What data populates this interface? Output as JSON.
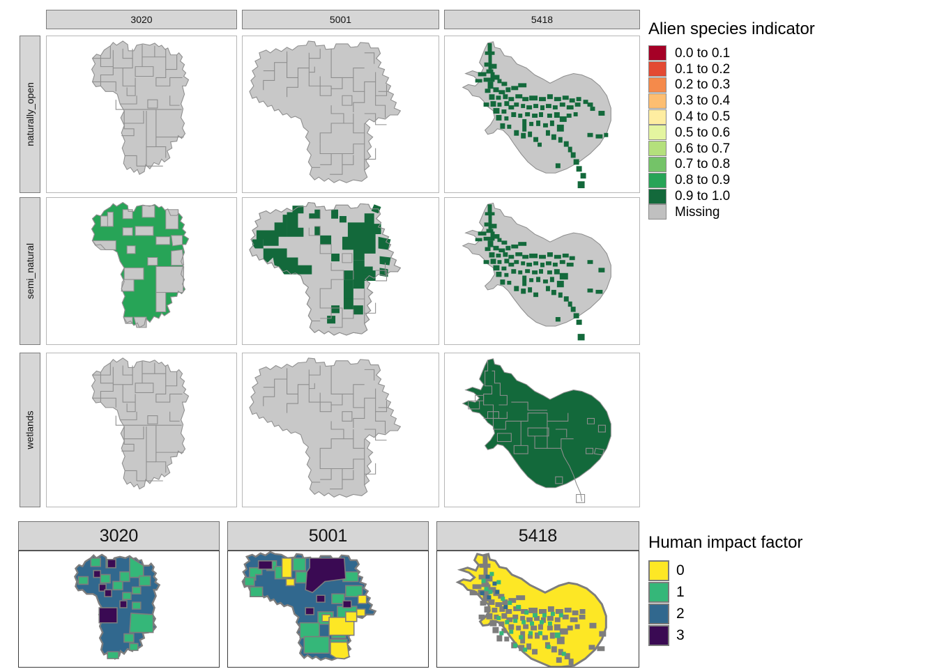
{
  "figure": {
    "kind": "faceted-choropleth-map-grid"
  },
  "top_grid": {
    "col_headers": [
      "3020",
      "5001",
      "5418"
    ],
    "row_headers": [
      "naturally_open",
      "semi_natural",
      "wetlands"
    ],
    "cells": [
      {
        "row": "naturally_open",
        "col": "3020",
        "fill_class": "Missing",
        "fill": "#c8c8c8"
      },
      {
        "row": "naturally_open",
        "col": "5001",
        "fill_class": "Missing",
        "fill": "#c8c8c8"
      },
      {
        "row": "naturally_open",
        "col": "5418",
        "fill_class": "Missing",
        "fill": "#c8c8c8",
        "overlay_class": "0.9 to 1.0",
        "overlay": "#13693b"
      },
      {
        "row": "semi_natural",
        "col": "3020",
        "fill_class": "0.8 to 0.9",
        "fill": "#27a457"
      },
      {
        "row": "semi_natural",
        "col": "5001",
        "fill_class": "0.9 to 1.0",
        "fill": "#13693b"
      },
      {
        "row": "semi_natural",
        "col": "5418",
        "fill_class": "Missing",
        "fill": "#c8c8c8",
        "overlay_class": "0.9 to 1.0",
        "overlay": "#13693b"
      },
      {
        "row": "wetlands",
        "col": "3020",
        "fill_class": "Missing",
        "fill": "#c8c8c8"
      },
      {
        "row": "wetlands",
        "col": "5001",
        "fill_class": "Missing",
        "fill": "#c8c8c8"
      },
      {
        "row": "wetlands",
        "col": "5418",
        "fill_class": "0.9 to 1.0",
        "fill": "#13693b"
      }
    ]
  },
  "bottom_grid": {
    "col_headers": [
      "3020",
      "5001",
      "5418"
    ],
    "cells": [
      {
        "col": "3020",
        "dominant_class": "2",
        "dominant": "#31688e"
      },
      {
        "col": "5001",
        "dominant_class": "2",
        "dominant": "#31688e"
      },
      {
        "col": "5418",
        "dominant_class": "0",
        "dominant": "#fde725"
      }
    ]
  },
  "legend_alien": {
    "title": "Alien species indicator",
    "items": [
      {
        "label": "0.0 to 0.1",
        "color": "#a50026"
      },
      {
        "label": "0.1 to 0.2",
        "color": "#e34a33"
      },
      {
        "label": "0.2 to 0.3",
        "color": "#f58a4b"
      },
      {
        "label": "0.3 to 0.4",
        "color": "#fdbe71"
      },
      {
        "label": "0.4 to 0.5",
        "color": "#feeda1"
      },
      {
        "label": "0.5 to 0.6",
        "color": "#e4f5a0"
      },
      {
        "label": "0.6 to 0.7",
        "color": "#b4e07c"
      },
      {
        "label": "0.7 to 0.8",
        "color": "#74c368"
      },
      {
        "label": "0.8 to 0.9",
        "color": "#27a457"
      },
      {
        "label": "0.9 to 1.0",
        "color": "#13693b"
      },
      {
        "label": "Missing",
        "color": "#c0c0c0"
      }
    ]
  },
  "legend_human": {
    "title": "Human impact factor",
    "items": [
      {
        "label": "0",
        "color": "#fde725"
      },
      {
        "label": "1",
        "color": "#35b779"
      },
      {
        "label": "2",
        "color": "#31688e"
      },
      {
        "label": "3",
        "color": "#3a0a53"
      }
    ]
  },
  "chart_data": {
    "type": "map",
    "title": "",
    "legend_position": "right",
    "panels_top": {
      "cols": [
        "3020",
        "5001",
        "5418"
      ],
      "rows": [
        "naturally_open",
        "semi_natural",
        "wetlands"
      ],
      "variable": "Alien species indicator",
      "values": [
        [
          "Missing",
          "Missing",
          "Missing + 0.9 to 1.0 network"
        ],
        [
          "0.8 to 0.9",
          "0.9 to 1.0",
          "Missing + 0.9 to 1.0 network"
        ],
        [
          "Missing",
          "Missing",
          "0.9 to 1.0"
        ]
      ]
    },
    "panels_bottom": {
      "cols": [
        "3020",
        "5001",
        "5418"
      ],
      "variable": "Human impact factor",
      "values": [
        "mostly 2 with 1 and 3",
        "mix of 0,1,2,3",
        "mostly 0"
      ]
    }
  }
}
